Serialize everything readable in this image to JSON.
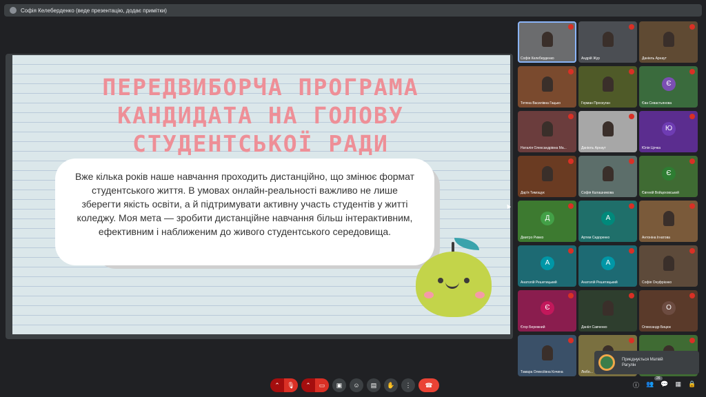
{
  "topbar": {
    "presenter_text": "Софія Келеберденко (веде презентацію, додає примітки)"
  },
  "slide": {
    "title": "ПЕРЕДВИБОРЧА ПРОГРАМА КАНДИДАТА НА ГОЛОВУ СТУДЕНТСЬКОЇ РАДИ",
    "body": "Вже кілька років наше навчання проходить дистанційно, що змінює формат студентського життя. В умовах онлайн-реальності важливо не лише зберегти якість освіти, а й підтримувати активну участь студентів у житті коледжу. Моя мета — зробити дистанційне навчання більш інтерактивним, ефективним і наближеним до живого студентського середовища."
  },
  "participants": [
    {
      "name": "Софія Келеберденко",
      "type": "photo",
      "bg": "#6b6c6e",
      "active": true
    },
    {
      "name": "Андрій Жур",
      "type": "photo",
      "bg": "#4b4e53"
    },
    {
      "name": "Даніель Арнаут",
      "type": "photo",
      "bg": "#5f4a33"
    },
    {
      "name": "Тетяна Василівна Гацько",
      "type": "photo",
      "bg": "#7a4a2e"
    },
    {
      "name": "Герман Проскуган",
      "type": "photo",
      "bg": "#4f5a28"
    },
    {
      "name": "Єва Севастьянова",
      "type": "avatar",
      "letter": "Є",
      "bg": "#3a6b3d",
      "avatar_color": "#7b4fb3"
    },
    {
      "name": "Наталія Олександрівна Ма...",
      "type": "photo",
      "bg": "#6b3d3d"
    },
    {
      "name": "Даніель Арнаут",
      "type": "photo",
      "bg": "#a7a7a7"
    },
    {
      "name": "Юлія Цочка",
      "type": "avatar",
      "letter": "Ю",
      "bg": "#5b2d8f",
      "avatar_color": "#6e3cb3"
    },
    {
      "name": "Дар'я Тимощук",
      "type": "photo",
      "bg": "#6a3b22"
    },
    {
      "name": "Софія Калашникова",
      "type": "photo",
      "bg": "#5c6e6a"
    },
    {
      "name": "Євгеній Войцеховський",
      "type": "avatar",
      "letter": "Є",
      "bg": "#3f6b33",
      "avatar_color": "#2e7d32"
    },
    {
      "name": "Дмитро Рижко",
      "type": "avatar",
      "letter": "Д",
      "bg": "#3d7a30",
      "avatar_color": "#43a047"
    },
    {
      "name": "Артем Сидоренко",
      "type": "avatar",
      "letter": "А",
      "bg": "#1f6f6a",
      "avatar_color": "#00897b"
    },
    {
      "name": "Антоніна Ігнатова",
      "type": "photo",
      "bg": "#7a5a3a"
    },
    {
      "name": "Анатолій Решетицький",
      "type": "avatar",
      "letter": "А",
      "bg": "#1d6a73",
      "avatar_color": "#0097a7"
    },
    {
      "name": "Анатолій Решетицький",
      "type": "avatar",
      "letter": "А",
      "bg": "#1d6a73",
      "avatar_color": "#0097a7"
    },
    {
      "name": "Софія Онуфрієнко",
      "type": "photo",
      "bg": "#5d4a3a"
    },
    {
      "name": "Єгор Бережний",
      "type": "avatar",
      "letter": "Є",
      "bg": "#8a1d4e",
      "avatar_color": "#c2185b"
    },
    {
      "name": "Данііл Савченко",
      "type": "photo",
      "bg": "#2e3e2e"
    },
    {
      "name": "Олександр Бицюк",
      "type": "avatar",
      "letter": "О",
      "bg": "#5a3a2a",
      "avatar_color": "#6d4c41"
    },
    {
      "name": "Тамара Олексіївна Кочина",
      "type": "photo",
      "bg": "#3a5068"
    },
    {
      "name": "Любо...",
      "type": "photo",
      "bg": "#7a7040"
    },
    {
      "name": "",
      "type": "photo",
      "bg": "#3f6b33"
    }
  ],
  "toast": {
    "text": "Приєднується Матвій Рагулін"
  },
  "controls": {
    "more_icon": "⋮",
    "participants_count": "26"
  }
}
